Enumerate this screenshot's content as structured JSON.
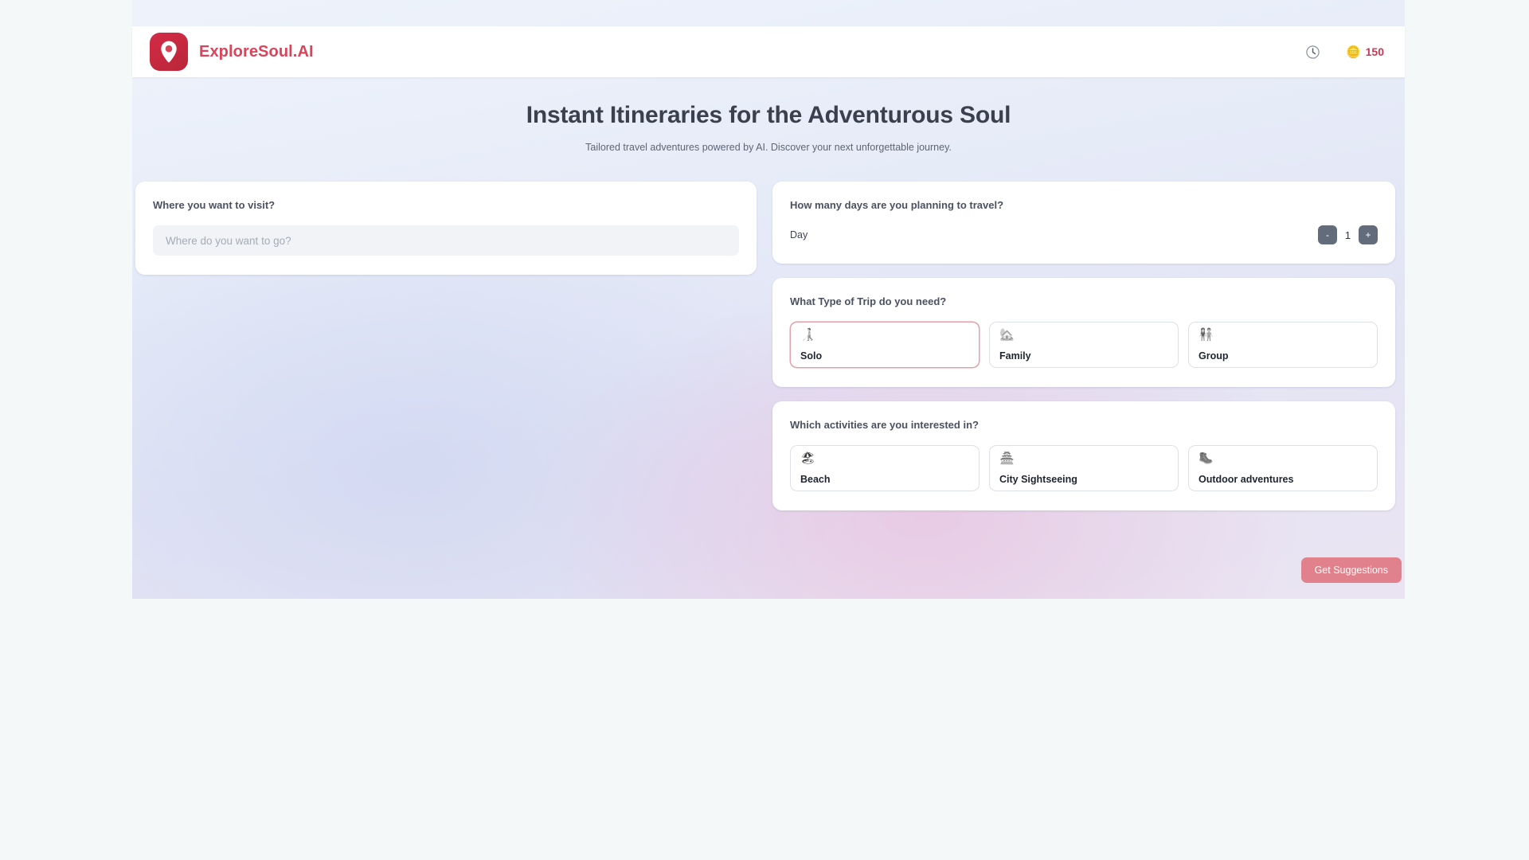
{
  "header": {
    "brand_name": "ExploreSoul.AI",
    "logo_icon": "map-pin-icon",
    "history_icon": "clock-icon",
    "coin_icon": "coins-icon",
    "coin_glyph": "🪙",
    "credits": "150"
  },
  "hero": {
    "title": "Instant Itineraries for the Adventurous Soul",
    "subtitle": "Tailored travel adventures powered by AI. Discover your next unforgettable journey."
  },
  "destination": {
    "label": "Where you want to visit?",
    "placeholder": "Where do you want to go?",
    "value": ""
  },
  "days": {
    "label": "How many days are you planning to travel?",
    "unit_label": "Day",
    "value": "1",
    "decrement_label": "-",
    "increment_label": "+"
  },
  "trip_type": {
    "label": "What Type of Trip do you need?",
    "options": [
      {
        "label": "Solo",
        "icon": "hiking-person-icon",
        "glyph": "🧑‍🦯",
        "selected": true
      },
      {
        "label": "Family",
        "icon": "family-icon",
        "glyph": "🏡",
        "selected": false
      },
      {
        "label": "Group",
        "icon": "people-group-icon",
        "glyph": "👫",
        "selected": false
      }
    ]
  },
  "activities": {
    "label": "Which activities are you interested in?",
    "options": [
      {
        "label": "Beach",
        "icon": "beach-umbrella-icon",
        "glyph": "🏖",
        "selected": false
      },
      {
        "label": "City Sightseeing",
        "icon": "pagoda-icon",
        "glyph": "🏯",
        "selected": false
      },
      {
        "label": "Outdoor adventures",
        "icon": "hiking-person-icon",
        "glyph": "🥾",
        "selected": false
      }
    ]
  },
  "submit": {
    "label": "Get Suggestions"
  },
  "colors": {
    "brand_red": "#d9445a",
    "logo_red": "#c5293f",
    "credits_text": "#c73a55",
    "submit_bg": "#e0818b",
    "selected_border": "#e3a0ab",
    "card_border": "#dde0e7",
    "stepper_bg": "#626c7a",
    "page_bg": "#f4f8f9"
  }
}
